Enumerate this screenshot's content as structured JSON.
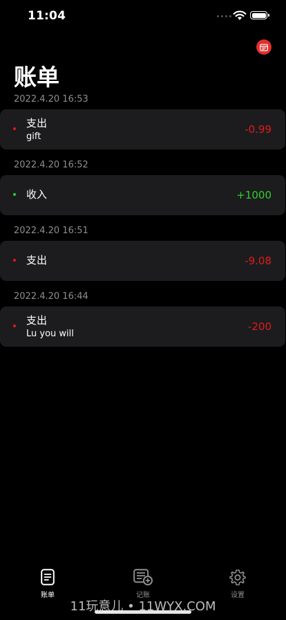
{
  "status": {
    "time": "11:04"
  },
  "header": {
    "title": "账单"
  },
  "entries": [
    {
      "timestamp": "2022.4.20 16:53",
      "category": "支出",
      "note": "gift",
      "amount": "-0.99"
    },
    {
      "timestamp": "2022.4.20 16:52",
      "category": "收入",
      "note": "",
      "amount": "+1000"
    },
    {
      "timestamp": "2022.4.20 16:51",
      "category": "支出",
      "note": "",
      "amount": "-9.08"
    },
    {
      "timestamp": "2022.4.20 16:44",
      "category": "支出",
      "note": "Lu you will",
      "amount": "-200"
    }
  ],
  "tabs": [
    {
      "label": "账单",
      "icon": "receipt-icon"
    },
    {
      "label": "记账",
      "icon": "add-entry-icon"
    },
    {
      "label": "设置",
      "icon": "gear-icon"
    }
  ],
  "watermark": "11玩意儿 • 11WYX.COM",
  "colors": {
    "expense": "#e01b1b",
    "income": "#2fd02f",
    "card": "#1c1c1e",
    "accent": "#e0302e"
  }
}
